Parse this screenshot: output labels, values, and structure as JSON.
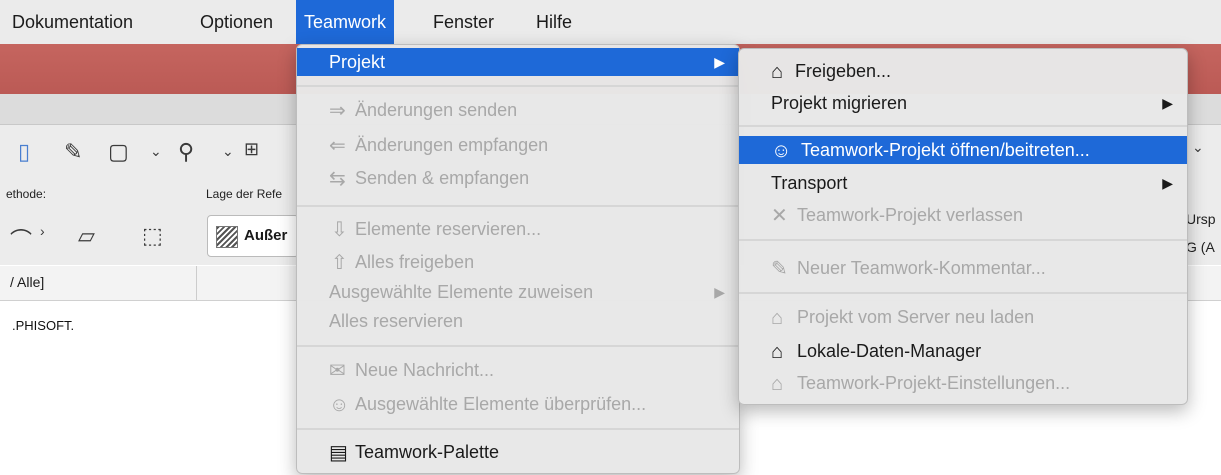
{
  "menubar": {
    "items": [
      "Dokumentation",
      "Optionen",
      "Teamwork",
      "Fenster",
      "Hilfe"
    ],
    "active_index": 2
  },
  "toolbox": {
    "method_label": "ethode:",
    "ref_label": "Lage der Refe",
    "hatch_label": "Außer",
    "right_labels": [
      "Ursp",
      "G (A"
    ]
  },
  "filter": {
    "text": "/ Alle]"
  },
  "footer": {
    "company": ".PHISOFT."
  },
  "teamwork_menu": {
    "projekt": "Projekt",
    "send": "Änderungen senden",
    "receive": "Änderungen empfangen",
    "send_receive": "Senden & empfangen",
    "reserve": "Elemente reservieren...",
    "release_all": "Alles freigeben",
    "assign": "Ausgewählte Elemente zuweisen",
    "reserve_all": "Alles reservieren",
    "new_message": "Neue Nachricht...",
    "check": "Ausgewählte Elemente überprüfen...",
    "palette": "Teamwork-Palette"
  },
  "projekt_submenu": {
    "share": "Freigeben...",
    "migrate": "Projekt migrieren",
    "open_join": "Teamwork-Projekt öffnen/beitreten...",
    "transport": "Transport",
    "leave": "Teamwork-Projekt verlassen",
    "new_comment": "Neuer Teamwork-Kommentar...",
    "reload": "Projekt vom Server neu laden",
    "local_data": "Lokale-Daten-Manager",
    "settings": "Teamwork-Projekt-Einstellungen..."
  },
  "colors": {
    "highlight": "#1e69d8",
    "disabled_text": "#a8a8a8",
    "titlebar": "#c5655f"
  },
  "icons": {
    "arrow_right_double": "⇒",
    "arrow_left_double": "⇐",
    "arrows_exchange": "⇆",
    "arrow_down_outline": "⇩",
    "arrow_up_outline": "⇧",
    "submenu_chevron": "▶",
    "house": "⌂",
    "comment": "✎",
    "message": "✉",
    "people": "☺",
    "palette": "▤",
    "leave": "✕"
  }
}
